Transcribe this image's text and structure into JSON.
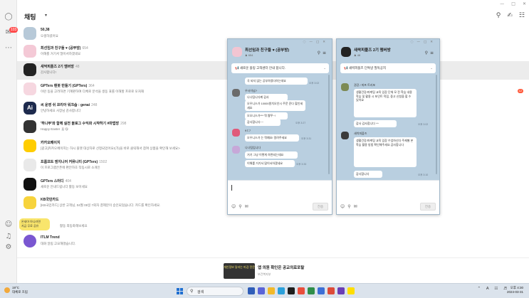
{
  "header": {
    "title": "채팅",
    "caret": "▾",
    "icons": [
      "search-icon",
      "new-chat-icon",
      "options-icon"
    ]
  },
  "rail": {
    "badge": "103"
  },
  "chats": [
    {
      "name": "50,38",
      "count": "",
      "preview": "오생하셨어요",
      "time": "",
      "badge": ""
    },
    {
      "name": "최선임과 친구들 ♥ (공부방)",
      "count": "654",
      "preview": "이해를 거기서 많이서하겠네요",
      "time": "",
      "badge": ""
    },
    {
      "name": "새싹피플즈 2기 멤버방",
      "count": "48",
      "preview": "감사합니다!",
      "time": "",
      "badge": ""
    },
    {
      "name": "GPTers 랜봇 만들기 (GPTers)",
      "count": "364",
      "preview": "이런 동을 고려하면 기계판하여 다체로 분석을 생동 표를 이해할 프로로 모처해",
      "time": "",
      "badge": "12"
    },
    {
      "name": "씨 운영 쉬 코리아 워크숍 : genai",
      "count": "248",
      "preview": "안녕하세요 사장님 감사합니다",
      "time": "",
      "badge": ""
    },
    {
      "name": "'하나부'와 함께 실전 블로그 수익화 시작하기 #마법방",
      "count": "298",
      "preview": "Happy Easter 🐰😋",
      "time": "",
      "badge": ""
    },
    {
      "name": "카카오페이지",
      "count": "",
      "preview": "[광고]카카오페이지는 하시 플랫 대상자로 선정되었어요!(가)을 바로 클릭해서 참여 상품을 확인해 보세요>",
      "time": "",
      "badge": ""
    },
    {
      "name": "프롬프트 엔지니어 커뮤니티 (GPTers)",
      "count": "1502",
      "preview": "이 프로그램은폰에 편안하호 작동시로 소개인",
      "time": "",
      "badge": ""
    },
    {
      "name": "GPTers 스터디",
      "count": "404",
      "preview": "새로운 안내드립니다 활동 보이세요",
      "time": "",
      "badge": ""
    },
    {
      "name": "KB국민카드",
      "count": "",
      "preview": "[KB국민카드] 상반 고객님, 04월 05일 7회차 결제분이 승인되었습니다. 카드를 확인하세요.",
      "time": "",
      "badge": ""
    },
    {
      "name": "",
      "count": "",
      "preview": "활동 최동화해보세요",
      "time": "",
      "badge": ""
    },
    {
      "name": "ITLM Trend",
      "count": "",
      "preview": "대화 알림 고요해졌습니다.",
      "time": "",
      "badge": ""
    }
  ],
  "promo": {
    "line1": "온새아 아니라면",
    "line2": "지금 무료 공유"
  },
  "ad": {
    "thumb_text": "개인정보 달라는 마감 전문",
    "title": "앱 의원 확인은 공교의료포탈",
    "subtitle": "보건복지부"
  },
  "win1": {
    "name": "최선임과 친구들 ♥ (공부방)",
    "members": "654",
    "notice": "새로운 블링 고객센터 안내 합니다.",
    "msgs": [
      {
        "text": "곡 되지 않는 공부하였다하는데요"
      },
      {
        "sender": "우사이넘?"
      },
      {
        "text": "나나팀니다께 감사"
      },
      {
        "text": "오우니스가 10000원치오인시 주문 준다 할인세세요"
      },
      {
        "text": "오오니스가*** 뭐 짭쭈~!"
      },
      {
        "text": "감사합니다~~"
      },
      {
        "sender": "9ㄷ7"
      },
      {
        "text": "오우니스가 는 뭐예요! 알려주세요"
      },
      {
        "sender": "나나팀입니다"
      },
      {
        "text": "거기 그냥 이렇게 하면되는데요"
      },
      {
        "text": "이해를 거기서 많이서하겠네요"
      }
    ],
    "times": [
      "오후 3:02",
      "오후 3:27",
      "오후 3:31",
      "오후 3:33"
    ],
    "send": "전송"
  },
  "win2": {
    "name": "새싹피플즈 2기 멤버방",
    "members": "48",
    "notice": "새싹피플즈 단톡방 필독공지",
    "msgs": [
      {
        "sender": "권강 / 피프 트리포"
      },
      {
        "text": "생활건강/마케팅 교육 입장 단체 모 전 학습 내용 학습 및 활용 시 포인트 적립, 중고 신청을 할 수 있어요"
      },
      {
        "text": "감사 감사합니다 ^^"
      },
      {
        "sender": "새싹피플즈"
      },
      {
        "text": "생활건강/마케팅 교육 입장 수업하신다 주제별 본 학습 활용 방법 확인해주세요 감사합니다"
      },
      {
        "text": "감사합니다"
      }
    ],
    "times": [
      "오후 3:02",
      "오후 3:10"
    ],
    "send": "전송"
  },
  "taskbar": {
    "temp": "19°C",
    "weather": "대체로 흐림",
    "search_placeholder": "검색",
    "time": "오후 4:30",
    "date": "2024-03-31"
  }
}
